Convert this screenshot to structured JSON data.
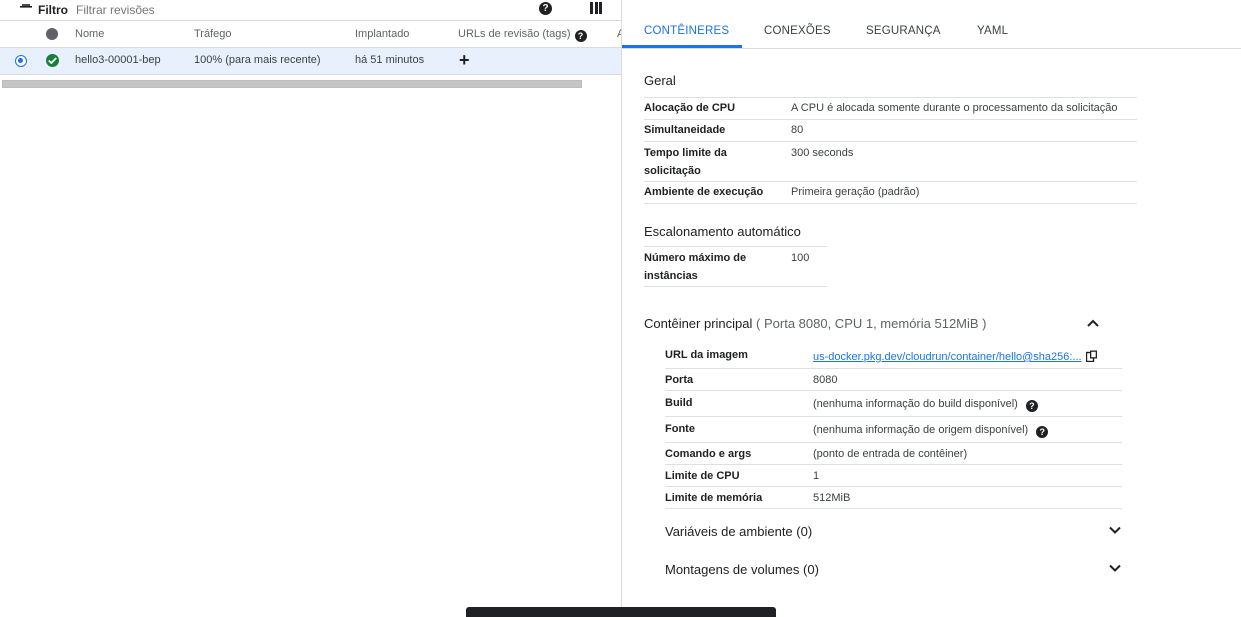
{
  "filter": {
    "label": "Filtro",
    "placeholder": "Filtrar revisões"
  },
  "table": {
    "headers": {
      "name": "Nome",
      "traffic": "Tráfego",
      "deployed": "Implantado",
      "urls": "URLs de revisão (tags)",
      "extra": "A"
    },
    "row": {
      "name": "hello3-00001-bep",
      "traffic": "100% (para mais recente)",
      "deployed": "há 51 minutos"
    }
  },
  "tabs": [
    "CONTÊINERES",
    "CONEXÕES",
    "SEGURANÇA",
    "YAML"
  ],
  "general": {
    "title": "Geral",
    "rows": [
      {
        "k": "Alocação de CPU",
        "v": "A CPU é alocada somente durante o processamento da solicitação"
      },
      {
        "k": "Simultaneidade",
        "v": "80"
      },
      {
        "k": "Tempo limite da solicitação",
        "v": "300 seconds"
      },
      {
        "k": "Ambiente de execução",
        "v": "Primeira geração (padrão)"
      }
    ]
  },
  "autoscale": {
    "title": "Escalonamento automático",
    "rows": [
      {
        "k": "Número máximo de instâncias",
        "v": "100"
      }
    ]
  },
  "container": {
    "title": "Contêiner principal",
    "subtitle": "( Porta 8080, CPU 1, memória 512MiB )",
    "rows": [
      {
        "k": "URL da imagem",
        "v": "us-docker.pkg.dev/cloudrun/container/hello@sha256:..."
      },
      {
        "k": "Porta",
        "v": "8080"
      },
      {
        "k": "Build",
        "v": "(nenhuma informação do build disponível)"
      },
      {
        "k": "Fonte",
        "v": "(nenhuma informação de origem disponível)"
      },
      {
        "k": "Comando e args",
        "v": "(ponto de entrada de contêiner)"
      },
      {
        "k": "Limite de CPU",
        "v": "1"
      },
      {
        "k": "Limite de memória",
        "v": "512MiB"
      }
    ]
  },
  "env_vars": {
    "label": "Variáveis de ambiente (0)"
  },
  "volumes": {
    "label": "Montagens de volumes (0)"
  },
  "icons": {
    "filter": "filter-icon",
    "help": "help-icon",
    "columns": "columns-icon",
    "check": "check-circle-icon",
    "add": "add-icon",
    "copy": "copy-icon",
    "expand": "chevron-icon"
  },
  "colors": {
    "accent": "#1a73e8",
    "selected_row": "#e8f0fe",
    "success": "#188038"
  },
  "glyphs": {
    "help": "?",
    "add": "+"
  }
}
